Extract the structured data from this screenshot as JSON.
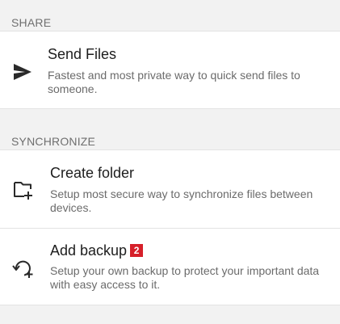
{
  "sections": {
    "share": {
      "header": "SHARE",
      "items": [
        {
          "title": "Send Files",
          "description": "Fastest and most private way to quick send files to someone.",
          "icon": "send-icon"
        }
      ]
    },
    "synchronize": {
      "header": "SYNCHRONIZE",
      "items": [
        {
          "title": "Create folder",
          "description": "Setup most secure way to synchronize files between devices.",
          "icon": "create-folder-icon"
        },
        {
          "title": "Add backup",
          "badge": "2",
          "description": "Setup your own backup to protect your important data with easy access to it.",
          "icon": "backup-icon"
        }
      ]
    }
  },
  "colors": {
    "background": "#f2f2f2",
    "card": "#ffffff",
    "header_text": "#6f6f6f",
    "badge": "#d6202a"
  }
}
